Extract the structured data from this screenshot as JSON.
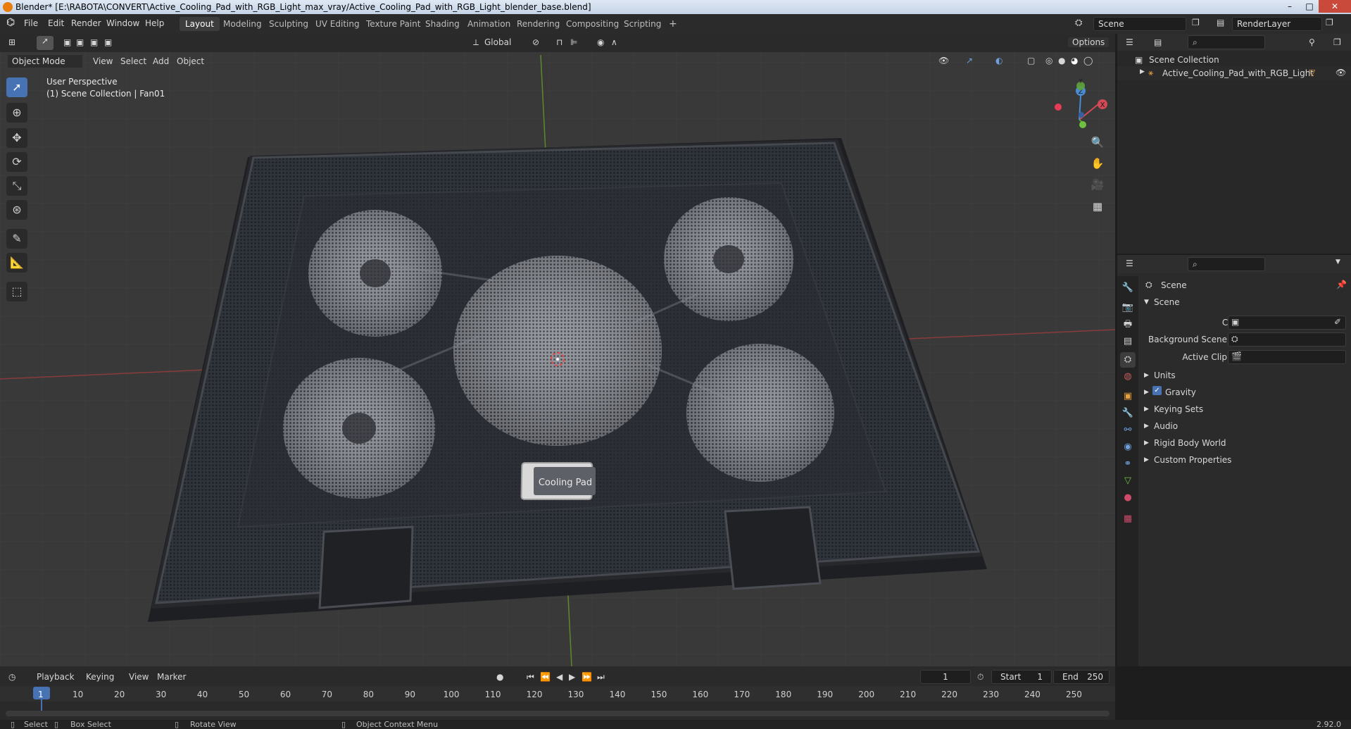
{
  "window": {
    "title": "Blender* [E:\\RABOTA\\CONVERT\\Active_Cooling_Pad_with_RGB_Light_max_vray/Active_Cooling_Pad_with_RGB_Light_blender_base.blend]",
    "minimize": "–",
    "maximize": "□",
    "close": "✕"
  },
  "menu": [
    "File",
    "Edit",
    "Render",
    "Window",
    "Help"
  ],
  "workspaces": [
    "Layout",
    "Modeling",
    "Sculpting",
    "UV Editing",
    "Texture Paint",
    "Shading",
    "Animation",
    "Rendering",
    "Compositing",
    "Scripting"
  ],
  "workspace_add": "+",
  "scene_field": "Scene",
  "renderlayer_field": "RenderLayer",
  "viewport": {
    "transform_orientation": "Global",
    "options": "Options",
    "mode": "Object Mode",
    "view": "View",
    "select": "Select",
    "add": "Add",
    "object": "Object",
    "perspective": "User Perspective",
    "collection_info": "(1) Scene Collection | Fan01",
    "axis_x": "X",
    "axis_y": "Y",
    "axis_z": "Z",
    "model_label": "Cooling Pad"
  },
  "outliner": {
    "root": "Scene Collection",
    "item": "Active_Cooling_Pad_with_RGB_Light"
  },
  "properties": {
    "header": "Scene",
    "panel": "Scene",
    "camera_label": "Camera",
    "background_scene_label": "Background Scene",
    "active_clip_label": "Active Clip",
    "sections": [
      "Units",
      "Gravity",
      "Keying Sets",
      "Audio",
      "Rigid Body World",
      "Custom Properties"
    ],
    "gravity_checked": true
  },
  "timeline": {
    "playback": "Playback",
    "keying": "Keying",
    "view": "View",
    "marker": "Marker",
    "current_frame": "1",
    "start_label": "Start",
    "start_value": "1",
    "end_label": "End",
    "end_value": "250",
    "ticks": [
      "1",
      "10",
      "20",
      "30",
      "40",
      "50",
      "60",
      "70",
      "80",
      "90",
      "100",
      "110",
      "120",
      "130",
      "140",
      "150",
      "160",
      "170",
      "180",
      "190",
      "200",
      "210",
      "220",
      "230",
      "240",
      "250"
    ]
  },
  "status": {
    "select": "Select",
    "box_select": "Box Select",
    "rotate_view": "Rotate View",
    "context_menu": "Object Context Menu",
    "version": "2.92.0"
  }
}
